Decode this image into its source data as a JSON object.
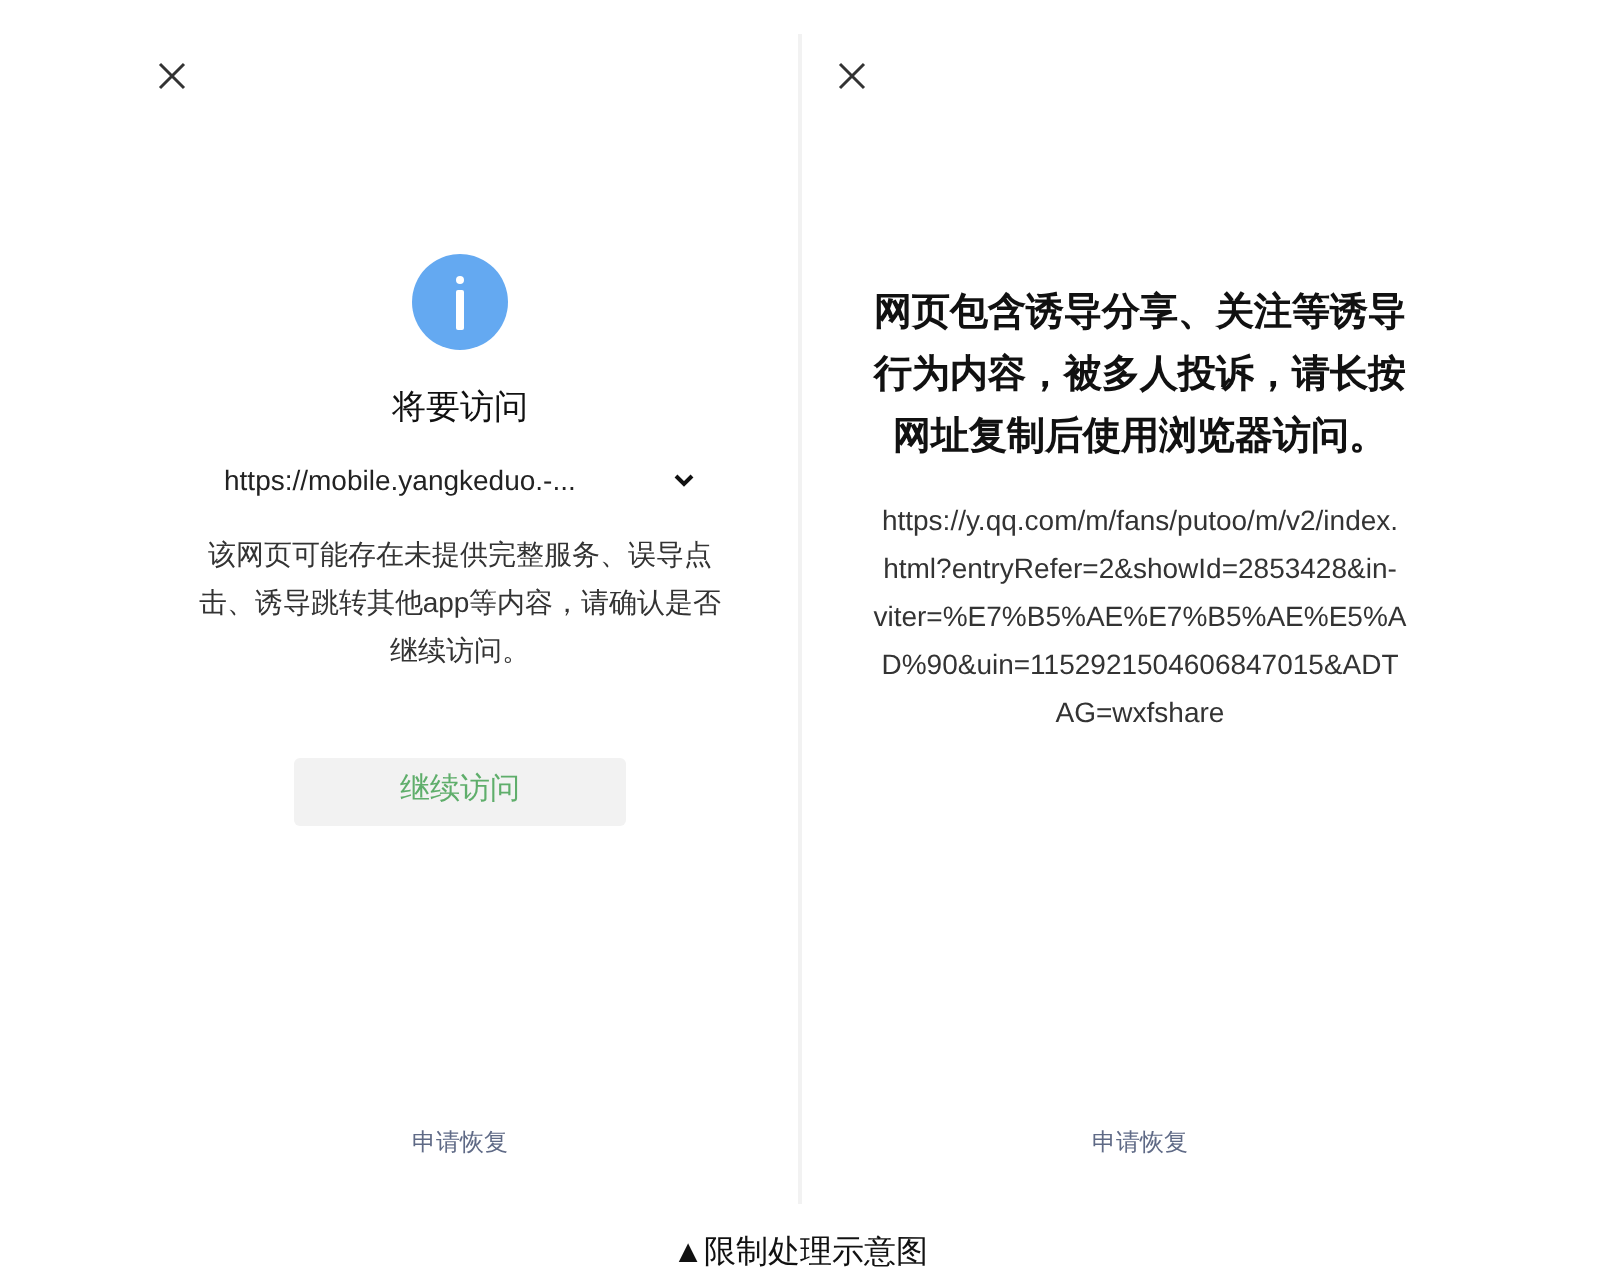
{
  "panels": [
    {
      "kind": "confirm",
      "title": "将要访问",
      "url": "https://mobile.yangkeduo.-...",
      "url_expanded": false,
      "message_lines": [
        "该网页可能存在未提供完整服务、误导点",
        "击、诱导跳转其他app等内容，请确认是否",
        "继续访问。"
      ],
      "button": "继续访问",
      "footer_link": "申请恢复"
    },
    {
      "kind": "blocked",
      "message_lines": [
        "网页包含诱导分享、关注等诱导",
        "行为内容，被多人投诉，请长按",
        "网址复制后使用浏览器访问。"
      ],
      "url_lines": [
        "https://y.qq.com/m/fans/putoo/m/v2/index.",
        "html?entryRefer=2&showId=2853428&in-",
        "viter=%E7%B5%AE%E7%B5%AE%E5%A",
        "D%90&uin=1152921504606847015&ADT",
        "AG=wxfshare"
      ],
      "footer_link": "申请恢复"
    }
  ],
  "caption": "▲限制处理示意图"
}
